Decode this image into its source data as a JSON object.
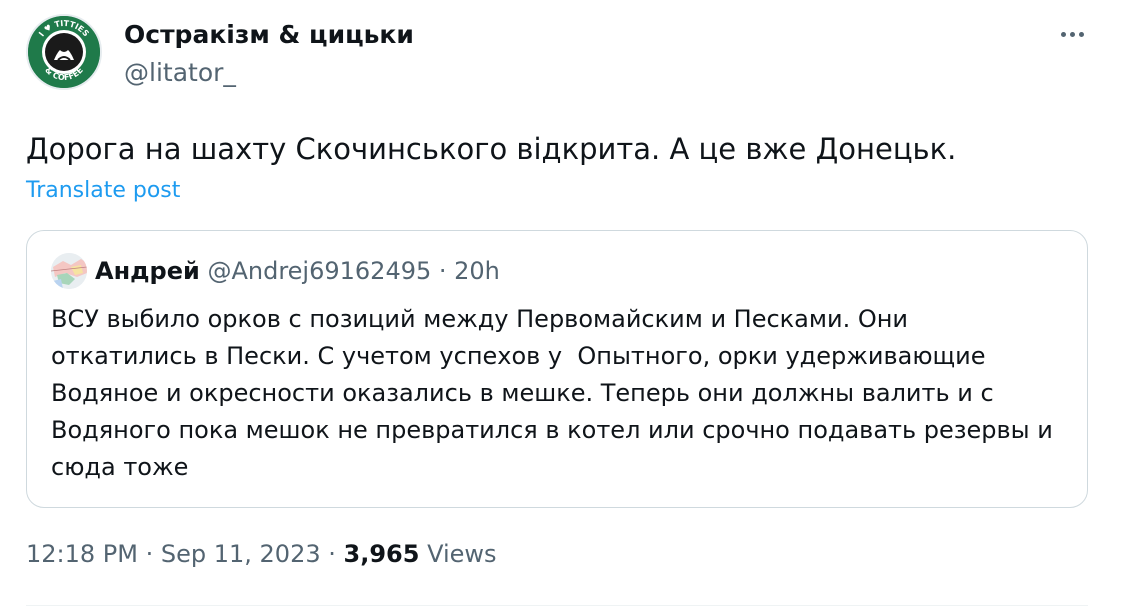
{
  "author": {
    "name": "Остракізм & цицьки",
    "handle": "@litator_",
    "avatar_icon": "starbucks-parody-logo",
    "avatar_text_top": "I ♥ TITTIES",
    "avatar_text_bottom": "& COFFEE"
  },
  "post": {
    "text": "Дорога на шахту Скочинського відкрита. А це вже Донецьк.",
    "translate_label": "Translate post"
  },
  "quote": {
    "name": "Андрей",
    "handle": "@Andrej69162495",
    "separator": " · ",
    "time": "20h",
    "lines": [
      "ВСУ выбило орков с позиций между Первомайским и Песками. Они",
      "откатились в Пески. С учетом успехов у  Опытного, орки удерживающие",
      "Водяное и окресности оказались в мешке. Теперь они должны валить и с",
      "Водяного пока мешок не превратился в котел или срочно подавать резервы и",
      "сюда тоже"
    ]
  },
  "meta": {
    "time": "12:18 PM",
    "dot": " · ",
    "date": "Sep 11, 2023",
    "views_count": "3,965",
    "views_label": " Views"
  },
  "colors": {
    "text": "#0f1419",
    "secondary": "#536471",
    "link": "#1d9bf0",
    "border": "#cfd9de"
  }
}
